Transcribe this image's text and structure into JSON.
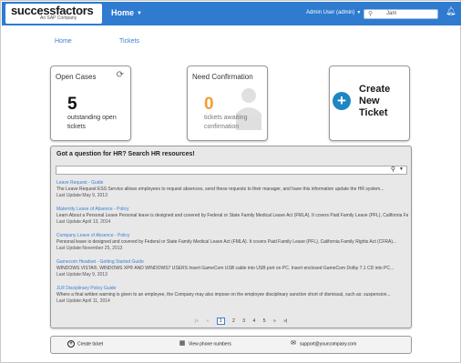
{
  "header": {
    "logo_text": "successfactors",
    "logo_sub": "An SAP Company",
    "nav_home": "Home",
    "user_label": "Admin User (admin)",
    "search_value": "Jam"
  },
  "breadcrumb": {
    "home": "Home",
    "tickets": "Tickets"
  },
  "tiles": {
    "open_cases": {
      "title": "Open Cases",
      "count": "5",
      "desc": "outstanding open tickets"
    },
    "need_confirmation": {
      "title": "Need Confirmation",
      "count": "0",
      "desc": "tickets awaiting confirmation"
    },
    "create": {
      "icon": "+",
      "label": "Create New Ticket"
    }
  },
  "hr": {
    "title": "Got a question for HR? Search HR resources!",
    "articles": [
      {
        "title": "Leave Request - Guide",
        "body": "The Leave Request ESS Service allows employees to request absences, send these requests to their manager, and have this information update the HR system...",
        "date": "Last Update:May 9, 2013"
      },
      {
        "title": "Maternity Leave of Absence - Policy",
        "body": "Learn About a Personal Leave Personal leave is designed and covered by Federal or State Family Medical Leave Act (FMLA). It covers Paid Family Leave (PFL), California Family Rights Act (CFRA)...",
        "date": "Last Update:April 13, 2014"
      },
      {
        "title": "Company Leave of Absence - Policy",
        "body": "Personal leave is designed and covered by Federal or State Family Medical Leave Act (FMLA). It covers Paid Family Leave (PFL), California Family Rights Act (CFRA)...",
        "date": "Last Update:November 25, 2013"
      },
      {
        "title": "Gamecom Headset - Getting Started Guide",
        "body": "WINDOWS VISTA®, WINDOWS XP® AND WINDOWS7 USERS Insert GameCom USB cable into USB port on PC. Insert enclosed GameCom Dolby 7.1 CD into PC...",
        "date": "Last Update:May 9, 2013"
      },
      {
        "title": "JLR Disciplinary Policy Guide",
        "body": "Where a final written warning is given to an employee, the Company may also impose on the employee disciplinary sanction short of dismissal, such as: suspension...",
        "date": "Last Update:April 11, 2014"
      }
    ],
    "pager": {
      "first": "|«",
      "prev": "«",
      "pages": [
        "1",
        "2",
        "3",
        "4",
        "5"
      ],
      "next": "»",
      "last": "»|"
    }
  },
  "footer": {
    "create_ticket": "Create ticket",
    "phone": "View phone numbers",
    "email": "support@yourcompany.com"
  },
  "colors": {
    "header_blue": "#2e7bd0",
    "link_blue": "#3a7fd5",
    "orange": "#f0a030",
    "create_icon": "#1e86c4"
  }
}
